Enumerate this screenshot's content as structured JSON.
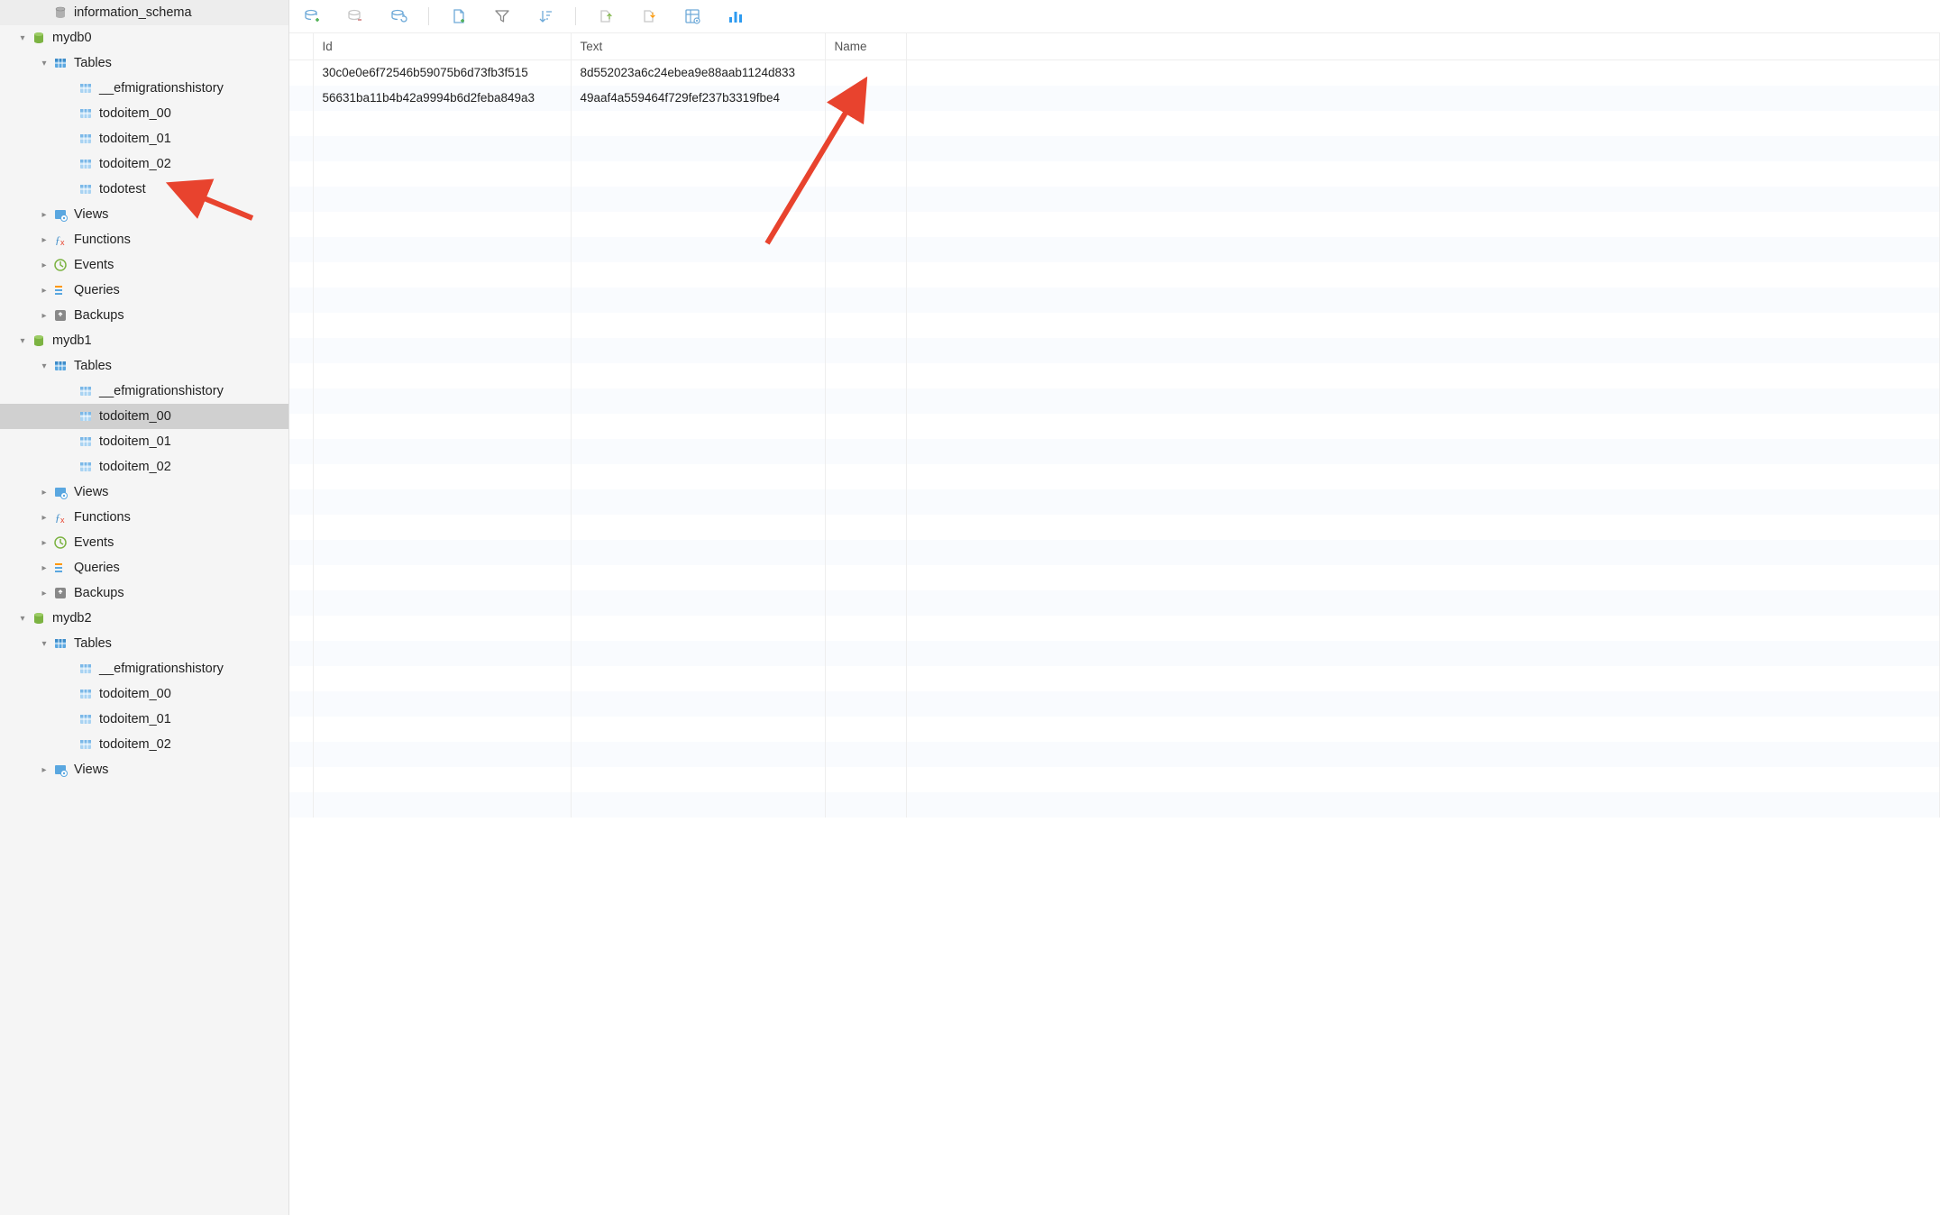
{
  "sidebar": {
    "nodes": [
      {
        "type": "db-sys",
        "label": "information_schema",
        "indent": "ind0",
        "chevron": ""
      },
      {
        "type": "db",
        "label": "mydb0",
        "indent": "ind1",
        "chevron": "down"
      },
      {
        "type": "tables",
        "label": "Tables",
        "indent": "ind2",
        "chevron": "down"
      },
      {
        "type": "table",
        "label": "__efmigrationshistory",
        "indent": "ind3",
        "chevron": ""
      },
      {
        "type": "table",
        "label": "todoitem_00",
        "indent": "ind3",
        "chevron": ""
      },
      {
        "type": "table",
        "label": "todoitem_01",
        "indent": "ind3",
        "chevron": ""
      },
      {
        "type": "table",
        "label": "todoitem_02",
        "indent": "ind3",
        "chevron": ""
      },
      {
        "type": "table",
        "label": "todotest",
        "indent": "ind3",
        "chevron": ""
      },
      {
        "type": "views",
        "label": "Views",
        "indent": "ind2",
        "chevron": "right"
      },
      {
        "type": "functions",
        "label": "Functions",
        "indent": "ind2",
        "chevron": "right"
      },
      {
        "type": "events",
        "label": "Events",
        "indent": "ind2",
        "chevron": "right"
      },
      {
        "type": "queries",
        "label": "Queries",
        "indent": "ind2",
        "chevron": "right"
      },
      {
        "type": "backups",
        "label": "Backups",
        "indent": "ind2",
        "chevron": "right"
      },
      {
        "type": "db",
        "label": "mydb1",
        "indent": "ind1",
        "chevron": "down"
      },
      {
        "type": "tables",
        "label": "Tables",
        "indent": "ind2",
        "chevron": "down"
      },
      {
        "type": "table",
        "label": "__efmigrationshistory",
        "indent": "ind3",
        "chevron": ""
      },
      {
        "type": "table",
        "label": "todoitem_00",
        "indent": "ind3",
        "chevron": "",
        "selected": true
      },
      {
        "type": "table",
        "label": "todoitem_01",
        "indent": "ind3",
        "chevron": ""
      },
      {
        "type": "table",
        "label": "todoitem_02",
        "indent": "ind3",
        "chevron": ""
      },
      {
        "type": "views",
        "label": "Views",
        "indent": "ind2",
        "chevron": "right"
      },
      {
        "type": "functions",
        "label": "Functions",
        "indent": "ind2",
        "chevron": "right"
      },
      {
        "type": "events",
        "label": "Events",
        "indent": "ind2",
        "chevron": "right"
      },
      {
        "type": "queries",
        "label": "Queries",
        "indent": "ind2",
        "chevron": "right"
      },
      {
        "type": "backups",
        "label": "Backups",
        "indent": "ind2",
        "chevron": "right"
      },
      {
        "type": "db",
        "label": "mydb2",
        "indent": "ind1",
        "chevron": "down"
      },
      {
        "type": "tables",
        "label": "Tables",
        "indent": "ind2",
        "chevron": "down"
      },
      {
        "type": "table",
        "label": "__efmigrationshistory",
        "indent": "ind3",
        "chevron": ""
      },
      {
        "type": "table",
        "label": "todoitem_00",
        "indent": "ind3",
        "chevron": ""
      },
      {
        "type": "table",
        "label": "todoitem_01",
        "indent": "ind3",
        "chevron": ""
      },
      {
        "type": "table",
        "label": "todoitem_02",
        "indent": "ind3",
        "chevron": ""
      },
      {
        "type": "views",
        "label": "Views",
        "indent": "ind2",
        "chevron": "right"
      }
    ]
  },
  "grid": {
    "columns": [
      "Id",
      "Text",
      "Name"
    ],
    "rows": [
      {
        "Id": "30c0e0e6f72546b59075b6d73fb3f515",
        "Text": "8d552023a6c24ebea9e88aab1124d833",
        "Name": ""
      },
      {
        "Id": "56631ba11b4b42a9994b6d2feba849a3",
        "Text": "49aaf4a559464f729fef237b3319fbe4",
        "Name": ""
      }
    ]
  }
}
